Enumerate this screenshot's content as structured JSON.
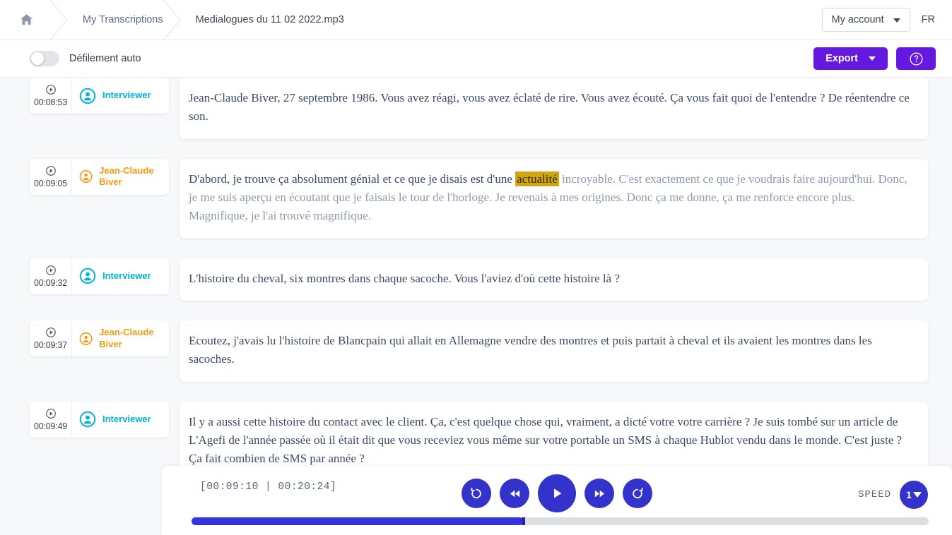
{
  "header": {
    "home_icon": "home-icon",
    "breadcrumbs": [
      {
        "label": "My Transcriptions"
      },
      {
        "label": "Medialogues du 11 02 2022.mp3"
      }
    ],
    "account_label": "My account",
    "language": "FR"
  },
  "toolbar": {
    "autoscroll_label": "Défilement auto",
    "autoscroll_on": false,
    "export_label": "Export",
    "help_icon": "question-circle-icon"
  },
  "colors": {
    "purple": "#6418e0",
    "player_blue": "#3333cc",
    "interviewer": "#00b3dd",
    "biver": "#f59a11",
    "highlight": "#d3a60e"
  },
  "segments": [
    {
      "time": "00:08:53",
      "speaker": "Interviewer",
      "speaker_color": "#00b3dd",
      "text_before": "Jean-Claude Biver, 27 septembre 1986. Vous avez réagi, vous avez éclaté de rire. Vous avez écouté. Ça vous fait quoi de l'entendre ? De réentendre ce son.",
      "highlight": "",
      "text_after": ""
    },
    {
      "time": "00:09:05",
      "speaker": "Jean-Claude Biver",
      "speaker_color": "#f59a11",
      "text_before": "D'abord, je trouve ça absolument génial et ce que je disais est d'une ",
      "highlight": "actualité",
      "text_after": " incroyable. C'est exactement ce que je voudrais faire aujourd'hui. Donc, je me suis aperçu en écoutant que je faisais le tour de l'horloge. Je revenais à mes origines. Donc ça me donne, ça me renforce encore plus. Magnifique, je l'ai trouvé magnifique."
    },
    {
      "time": "00:09:32",
      "speaker": "Interviewer",
      "speaker_color": "#00b3dd",
      "text_before": "L'histoire du cheval, six montres dans chaque sacoche. Vous l'aviez d'où cette histoire là ?",
      "highlight": "",
      "text_after": ""
    },
    {
      "time": "00:09:37",
      "speaker": "Jean-Claude Biver",
      "speaker_color": "#f59a11",
      "text_before": "Ecoutez, j'avais lu l'histoire de Blancpain qui allait en Allemagne vendre des montres et puis partait à cheval et ils avaient les montres dans les sacoches.",
      "highlight": "",
      "text_after": ""
    },
    {
      "time": "00:09:49",
      "speaker": "Interviewer",
      "speaker_color": "#00b3dd",
      "text_before": "Il y a aussi cette histoire du contact avec le client. Ça, c'est quelque chose qui, vraiment, a dicté votre votre carrière ? Je suis tombé sur un article de L'Agefi de l'année passée où il était dit que vous receviez vous même sur votre portable un SMS à chaque Hublot vendu dans le monde. C'est juste ? Ça fait combien de SMS par année ?",
      "highlight": "",
      "text_after": ""
    }
  ],
  "player": {
    "timecode": "[00:09:10 | 00:20:24]",
    "current_time": "00:09:10",
    "total_time": "00:20:24",
    "speed_label": "SPEED",
    "speed_value": "1",
    "progress_percent": 45,
    "controls": [
      {
        "name": "replay-back-button",
        "icon": "rotate-left-icon"
      },
      {
        "name": "rewind-button",
        "icon": "fast-rewind-icon"
      },
      {
        "name": "play-button",
        "icon": "play-icon"
      },
      {
        "name": "forward-button",
        "icon": "fast-forward-icon"
      },
      {
        "name": "replay-forward-button",
        "icon": "rotate-right-icon"
      }
    ]
  }
}
